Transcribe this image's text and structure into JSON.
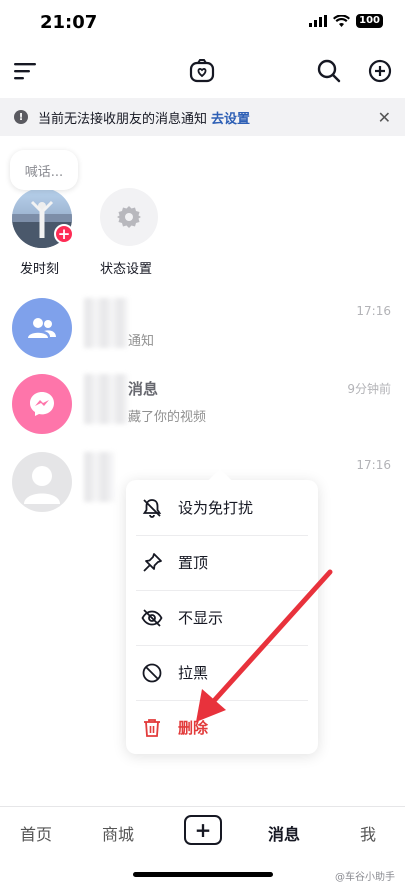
{
  "status_bar": {
    "time": "21:07",
    "battery": "100"
  },
  "notice": {
    "text": "当前无法接收朋友的消息通知",
    "link": "去设置",
    "icon": "!"
  },
  "stories": {
    "bubble": "喊话...",
    "items": [
      {
        "label": "发时刻"
      },
      {
        "label": "状态设置"
      }
    ]
  },
  "conversations": [
    {
      "name": "",
      "preview": "通知",
      "time": "17:16",
      "avatar_color": "#3b6fe0"
    },
    {
      "name": "消息",
      "preview": "藏了你的视频",
      "time": "9分钟前",
      "avatar_color": "#fe2c7d"
    },
    {
      "name": "",
      "preview": "",
      "time": "17:16",
      "avatar_color": "#d8d8da"
    }
  ],
  "context_menu": {
    "items": [
      {
        "label": "设为免打扰",
        "icon": "bell-off-icon"
      },
      {
        "label": "置顶",
        "icon": "pin-icon"
      },
      {
        "label": "不显示",
        "icon": "eye-off-icon"
      },
      {
        "label": "拉黑",
        "icon": "block-icon"
      },
      {
        "label": "删除",
        "icon": "trash-icon"
      }
    ]
  },
  "tabbar": {
    "items": [
      {
        "label": "首页"
      },
      {
        "label": "商城"
      },
      {
        "label": "+"
      },
      {
        "label": "消息"
      },
      {
        "label": "我"
      }
    ]
  },
  "watermark": "@车谷小助手",
  "colors": {
    "accent_red": "#e23b3b",
    "link_blue": "#2d5fb5",
    "badge_red": "#fe2c55"
  }
}
